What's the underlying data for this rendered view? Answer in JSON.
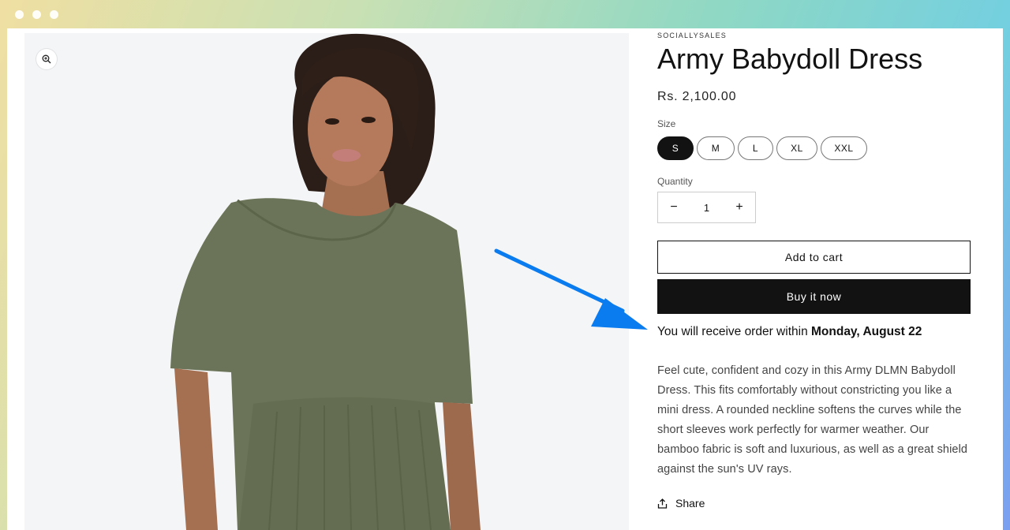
{
  "product": {
    "vendor": "SOCIALLYSALES",
    "title": "Army Babydoll Dress",
    "price": "Rs. 2,100.00",
    "size_label": "Size",
    "sizes": [
      "S",
      "M",
      "L",
      "XL",
      "XXL"
    ],
    "selected_size": "S",
    "quantity_label": "Quantity",
    "quantity": "1",
    "decrease_symbol": "−",
    "increase_symbol": "+",
    "add_to_cart": "Add to cart",
    "buy_now": "Buy it now",
    "delivery_prefix": "You will receive order within ",
    "delivery_date": "Monday, August 22",
    "description": "Feel cute, confident and cozy in this Army DLMN Babydoll Dress. This fits comfortably without constricting you like a mini dress. A rounded neckline softens the curves while the short sleeves work perfectly for warmer weather. Our bamboo fabric is soft and luxurious, as well as a great shield against the sun's UV rays.",
    "share_label": "Share"
  },
  "icons": {
    "zoom": "zoom-in-icon",
    "share": "share-icon",
    "arrow": "arrow-annotation"
  },
  "colors": {
    "accent_arrow": "#0a7cf0",
    "button_dark": "#121212",
    "dress": "#6b7458"
  }
}
